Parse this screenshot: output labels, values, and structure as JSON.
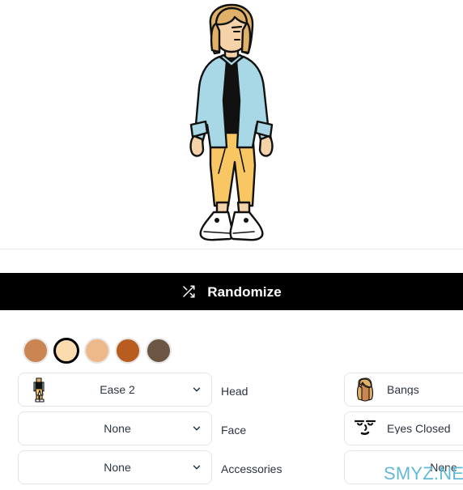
{
  "preview": {
    "alt_name": "character-preview",
    "skin_color": "#f5d2a8",
    "hair_color": "#dfb068",
    "hair_shadow": "#c79748",
    "shirt_color": "#a8d8e6",
    "shirt_shadow": "#8cc5d6",
    "top_color": "#111111",
    "pants_color": "#f8c764",
    "pants_shadow": "#e8b34e",
    "shoe_color": "#ffffff",
    "outline_color": "#111111"
  },
  "randomize": {
    "label": "Randomize",
    "icon": "shuffle-icon",
    "background": "#000000",
    "text_color": "#ffffff"
  },
  "skin_tones": [
    {
      "name": "skin-tone-1",
      "color": "#cb8552",
      "selected": false
    },
    {
      "name": "skin-tone-2",
      "color": "#fbdcaf",
      "selected": true
    },
    {
      "name": "skin-tone-3",
      "color": "#eeb98a",
      "selected": false
    },
    {
      "name": "skin-tone-4",
      "color": "#b85c20",
      "selected": false
    },
    {
      "name": "skin-tone-5",
      "color": "#6b5644",
      "selected": false
    }
  ],
  "options": [
    {
      "label": "Head",
      "left": {
        "value": "Ease 2",
        "thumb": "body-pose-thumb",
        "caret": true
      },
      "right": {
        "value": "Bangs",
        "thumb": "hair-bangs-thumb",
        "caret": false
      }
    },
    {
      "label": "Face",
      "left": {
        "value": "None",
        "thumb": null,
        "caret": true
      },
      "right": {
        "value": "Eyes Closed",
        "thumb": "face-eyes-closed-thumb",
        "caret": false
      }
    },
    {
      "label": "Accessories",
      "left": {
        "value": "None",
        "thumb": null,
        "caret": true
      },
      "right": {
        "value": "None",
        "thumb": null,
        "caret": false
      }
    }
  ],
  "watermark": {
    "text": "SMYZ.NET",
    "color": "#63b9d6"
  }
}
